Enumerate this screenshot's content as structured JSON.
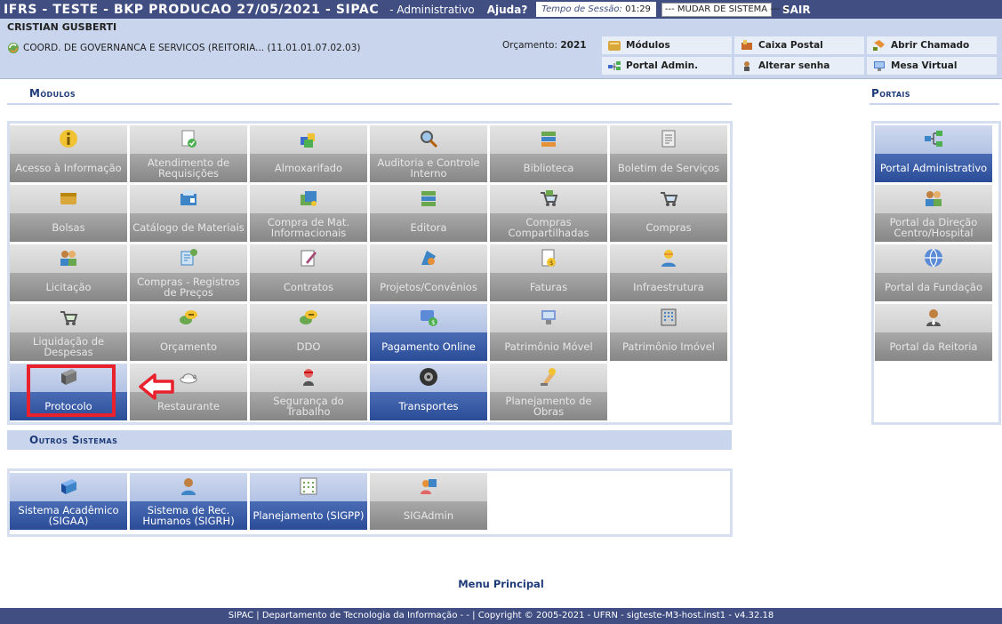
{
  "topbar": {
    "title": "IFRS - TESTE - BKP PRODUCAO 27/05/2021 - SIPAC",
    "subtitle": "- Administrativo",
    "help": "Ajuda?",
    "session_label": "Tempo de Sessão:",
    "session_time": "01:29",
    "system_select": "--- MUDAR DE SISTEMA ---",
    "logout": "SAIR"
  },
  "user": {
    "name": "CRISTIAN GUSBERTI",
    "unit": "COORD. DE GOVERNANCA E SERVICOS (REITORIA... (11.01.01.07.02.03)",
    "budget_label": "Orçamento:",
    "budget_year": "2021"
  },
  "quick_links": [
    {
      "label": "Módulos",
      "icon": "modules-icon"
    },
    {
      "label": "Caixa Postal",
      "icon": "mailbox-icon"
    },
    {
      "label": "Abrir Chamado",
      "icon": "ticket-icon"
    },
    {
      "label": "Portal Admin.",
      "icon": "portal-admin-icon"
    },
    {
      "label": "Alterar senha",
      "icon": "password-icon"
    },
    {
      "label": "Mesa Virtual",
      "icon": "virtual-desk-icon"
    }
  ],
  "sections": {
    "modules": "Módulos",
    "portals": "Portais",
    "other": "Outros Sistemas"
  },
  "modules": [
    {
      "label": "Acesso à Informação",
      "style": "gray",
      "icon": "info-icon"
    },
    {
      "label": "Atendimento de Requisições",
      "style": "gray",
      "icon": "requests-icon"
    },
    {
      "label": "Almoxarifado",
      "style": "gray",
      "icon": "warehouse-icon"
    },
    {
      "label": "Auditoria e Controle Interno",
      "style": "gray",
      "icon": "audit-icon"
    },
    {
      "label": "Biblioteca",
      "style": "gray",
      "icon": "library-icon"
    },
    {
      "label": "Boletim de Serviços",
      "style": "gray",
      "icon": "bulletin-icon"
    },
    {
      "label": "Bolsas",
      "style": "gray",
      "icon": "scholarship-icon"
    },
    {
      "label": "Catálogo de Materiais",
      "style": "gray",
      "icon": "catalog-icon"
    },
    {
      "label": "Compra de Mat. Informacionais",
      "style": "gray",
      "icon": "books-purchase-icon"
    },
    {
      "label": "Editora",
      "style": "gray",
      "icon": "publisher-icon"
    },
    {
      "label": "Compras Compartilhadas",
      "style": "gray",
      "icon": "shared-cart-icon"
    },
    {
      "label": "Compras",
      "style": "gray",
      "icon": "cart-icon"
    },
    {
      "label": "Licitação",
      "style": "gray",
      "icon": "bidding-icon"
    },
    {
      "label": "Compras - Registros de Preços",
      "style": "gray",
      "icon": "price-registry-icon"
    },
    {
      "label": "Contratos",
      "style": "gray",
      "icon": "contract-icon"
    },
    {
      "label": "Projetos/Convênios",
      "style": "gray",
      "icon": "projects-icon"
    },
    {
      "label": "Faturas",
      "style": "gray",
      "icon": "invoice-icon"
    },
    {
      "label": "Infraestrutura",
      "style": "gray",
      "icon": "worker-icon"
    },
    {
      "label": "Liquidação de Despesas",
      "style": "gray",
      "icon": "expense-cart-icon"
    },
    {
      "label": "Orçamento",
      "style": "gray",
      "icon": "budget-icon"
    },
    {
      "label": "DDO",
      "style": "gray",
      "icon": "ddo-icon"
    },
    {
      "label": "Pagamento Online",
      "style": "blue",
      "icon": "payment-icon"
    },
    {
      "label": "Patrimônio Móvel",
      "style": "gray",
      "icon": "movable-asset-icon"
    },
    {
      "label": "Patrimônio Imóvel",
      "style": "gray",
      "icon": "building-icon"
    },
    {
      "label": "Protocolo",
      "style": "blue",
      "icon": "protocol-book-icon"
    },
    {
      "label": "Restaurante",
      "style": "gray",
      "icon": "restaurant-icon"
    },
    {
      "label": "Segurança do Trabalho",
      "style": "gray",
      "icon": "safety-icon"
    },
    {
      "label": "Transportes",
      "style": "blue",
      "icon": "wheel-icon"
    },
    {
      "label": "Planejamento de Obras",
      "style": "gray",
      "icon": "construction-icon"
    }
  ],
  "portals": [
    {
      "label": "Portal Administrativo",
      "style": "blue",
      "icon": "network-icon"
    },
    {
      "label": "Portal da Direção Centro/Hospital",
      "style": "gray",
      "icon": "directors-icon"
    },
    {
      "label": "Portal da Fundação",
      "style": "gray",
      "icon": "globe-icon"
    },
    {
      "label": "Portal da Reitoria",
      "style": "gray",
      "icon": "rector-icon"
    }
  ],
  "other_systems": [
    {
      "label": "Sistema Acadêmico (SIGAA)",
      "style": "blue",
      "icon": "academic-book-icon"
    },
    {
      "label": "Sistema de Rec. Humanos (SIGRH)",
      "style": "blue",
      "icon": "hr-person-icon"
    },
    {
      "label": "Planejamento (SIGPP)",
      "style": "blue",
      "icon": "planning-icon"
    },
    {
      "label": "SIGAdmin",
      "style": "gray",
      "icon": "admin-users-icon"
    }
  ],
  "footer": {
    "menu_principal": "Menu Principal",
    "text": "SIPAC | Departamento de Tecnologia da Informação - - | Copyright © 2005-2021 - UFRN - sigteste-M3-host.inst1 - v4.32.18"
  }
}
